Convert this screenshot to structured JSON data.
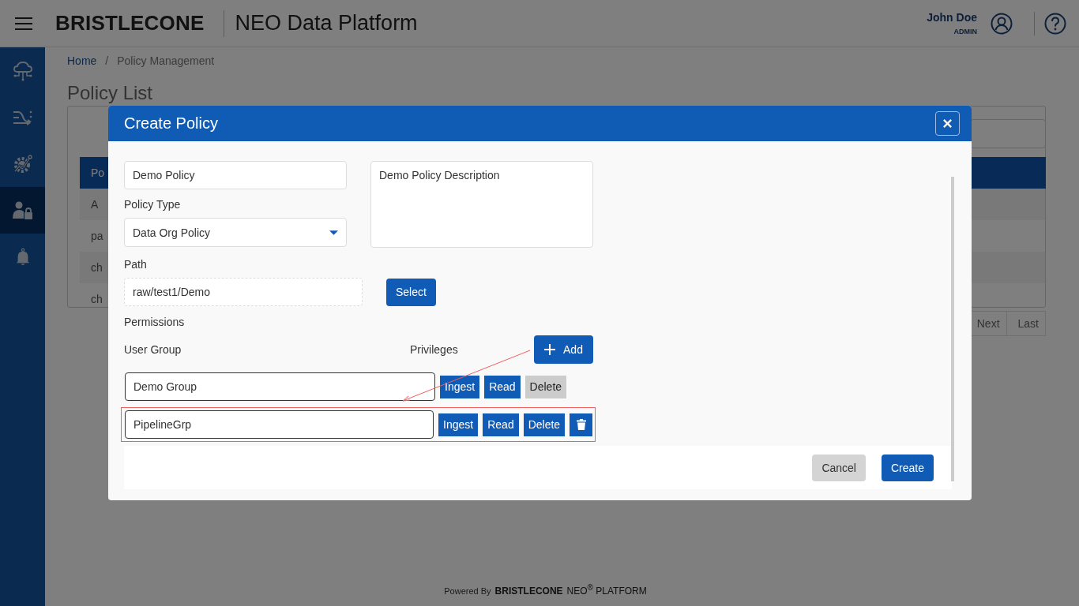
{
  "header": {
    "brand": "BRISTLECONE",
    "title": "NEO Data Platform",
    "user": {
      "name": "John Doe",
      "role": "ADMIN"
    }
  },
  "sidebar": {
    "items": [
      {
        "kind": "cloud",
        "selected": false
      },
      {
        "kind": "shuffle",
        "selected": false
      },
      {
        "kind": "gear",
        "selected": false
      },
      {
        "kind": "user-lock",
        "selected": true
      },
      {
        "kind": "bell",
        "selected": false
      }
    ]
  },
  "breadcrumb": [
    {
      "label": "Home",
      "kind": "link"
    },
    {
      "label": "Policy Management",
      "kind": "current"
    }
  ],
  "breadcrumb_separator": "/",
  "page_title": "Policy List",
  "table": {
    "columns": [
      "Po"
    ],
    "rows": [
      [
        "A"
      ],
      [
        "pa"
      ],
      [
        "ch"
      ],
      [
        "ch"
      ]
    ]
  },
  "pagination": [
    {
      "label": "Next"
    },
    {
      "label": "Last"
    }
  ],
  "footer": {
    "powered_by": "Powered By",
    "brand": "BRISTLECONE",
    "product": "NEO$^{®}$ PLATFORM"
  },
  "dialog": {
    "title": "Create Policy",
    "name": "Demo Policy",
    "description": "Demo Policy Description",
    "policy_type_label": "Policy Type",
    "policy_type": "Data Org Policy",
    "path_label": "Path",
    "path": "raw/test1/Demo",
    "select_button": "Select",
    "permissions_label": "Permissions",
    "user_group_label": "User Group",
    "privileges_label": "Privileges",
    "add_button": "Add",
    "permissions": [
      {
        "group": "Demo Group",
        "highlighted": false,
        "removable": false,
        "privileges": [
          {
            "label": "Ingest",
            "selected": true
          },
          {
            "label": "Read",
            "selected": true
          },
          {
            "label": "Delete",
            "selected": false
          }
        ]
      },
      {
        "group": "PipelineGrp",
        "highlighted": true,
        "removable": true,
        "privileges": [
          {
            "label": "Ingest",
            "selected": true
          },
          {
            "label": "Read",
            "selected": true
          },
          {
            "label": "Delete",
            "selected": true
          }
        ]
      }
    ],
    "buttons": [
      {
        "label": "Cancel",
        "kind": "secondary"
      },
      {
        "label": "Create",
        "kind": "primary"
      }
    ]
  }
}
